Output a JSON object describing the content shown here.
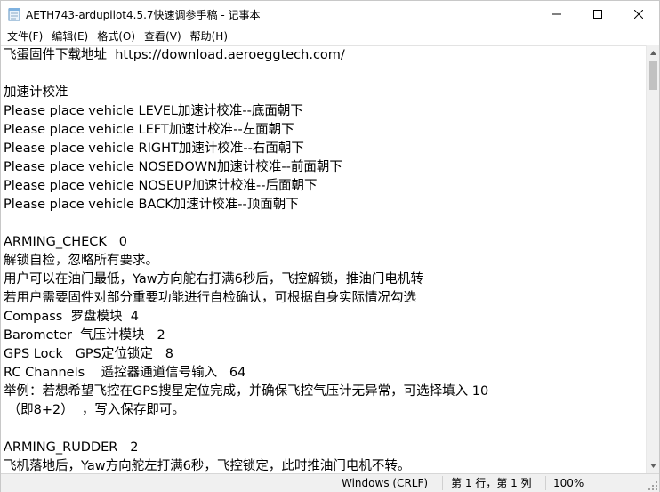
{
  "window": {
    "title": "AETH743-ardupilot4.5.7快速调参手稿 - 记事本"
  },
  "menu": {
    "items": [
      "文件(F)",
      "编辑(E)",
      "格式(O)",
      "查看(V)",
      "帮助(H)"
    ]
  },
  "editor": {
    "lines": [
      "飞蛋固件下载地址  https://download.aeroeggtech.com/",
      "",
      "加速计校准",
      "Please place vehicle LEVEL加速计校准--底面朝下",
      "Please place vehicle LEFT加速计校准--左面朝下",
      "Please place vehicle RIGHT加速计校准--右面朝下",
      "Please place vehicle NOSEDOWN加速计校准--前面朝下",
      "Please place vehicle NOSEUP加速计校准--后面朝下",
      "Please place vehicle BACK加速计校准--顶面朝下",
      "",
      "ARMING_CHECK   0",
      "解锁自检，忽略所有要求。",
      "用户可以在油门最低，Yaw方向舵右打满6秒后，飞控解锁，推油门电机转",
      "若用户需要固件对部分重要功能进行自检确认，可根据自身实际情况勾选",
      "Compass  罗盘模块  4",
      "Barometer  气压计模块   2",
      "GPS Lock   GPS定位锁定   8",
      "RC Channels    遥控器通道信号输入   64",
      "举例：若想希望飞控在GPS搜星定位完成，并确保飞控气压计无异常，可选择填入 10",
      " （即8+2）  ，写入保存即可。",
      "",
      "ARMING_RUDDER   2",
      "飞机落地后，Yaw方向舵左打满6秒，飞控锁定，此时推油门电机不转。"
    ]
  },
  "status": {
    "line_ending": "Windows (CRLF)",
    "position": "第 1 行，第 1 列",
    "zoom": "100%"
  }
}
